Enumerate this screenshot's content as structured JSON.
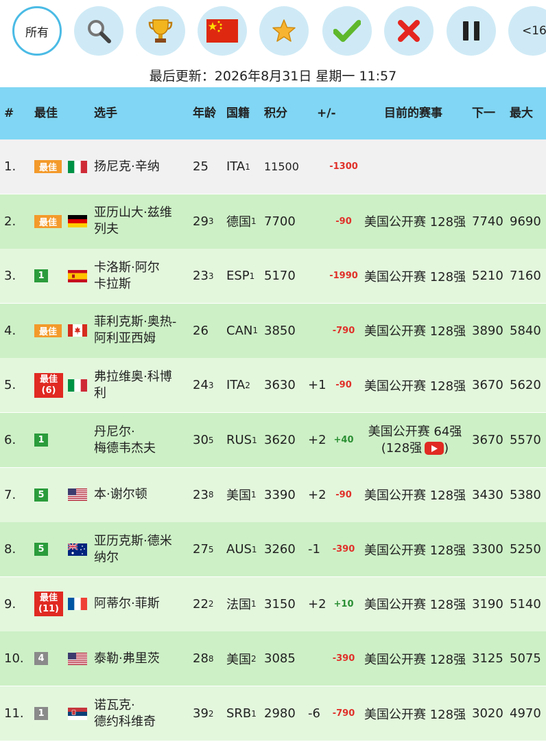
{
  "filter_bar": {
    "all_label": "所有",
    "more_label": "<16",
    "buttons": [
      {
        "name": "all-filter-button",
        "icon": "text"
      },
      {
        "name": "search-filter-button",
        "icon": "search-icon"
      },
      {
        "name": "trophy-filter-button",
        "icon": "trophy-icon"
      },
      {
        "name": "china-filter-button",
        "icon": "china-flag-icon"
      },
      {
        "name": "star-filter-button",
        "icon": "star-icon"
      },
      {
        "name": "check-filter-button",
        "icon": "check-icon"
      },
      {
        "name": "cross-filter-button",
        "icon": "cross-icon"
      },
      {
        "name": "pause-filter-button",
        "icon": "pause-icon"
      },
      {
        "name": "under16-filter-button",
        "icon": "text"
      }
    ]
  },
  "update_line": "最后更新：2026年8月31日 星期一 11:57",
  "table": {
    "headers": {
      "rank": "#",
      "best": "最佳",
      "player": "选手",
      "age": "年龄",
      "country": "国籍",
      "points": "积分",
      "plusminus": "+/-",
      "event": "目前的赛事",
      "next": "下一",
      "max": "最大"
    },
    "colors": {
      "header_bg": "#80d6f4",
      "row_odd": "#e3f7dd",
      "row_even": "#cdf0c6",
      "first_row": "#f1f1f1"
    },
    "rows": [
      {
        "rank": "1.",
        "best": {
          "type": "best",
          "text": "最佳"
        },
        "flag": "italy-flag-icon",
        "name": "扬尼克·辛纳",
        "name2": "",
        "age": "25",
        "age_sub": "",
        "country": "ITA",
        "country_sub": "1",
        "points": "11500",
        "move": "",
        "change": "-1300",
        "change_type": "neg",
        "event": "",
        "event2": "",
        "yt": false,
        "next": "",
        "max": ""
      },
      {
        "rank": "2.",
        "best": {
          "type": "best",
          "text": "最佳"
        },
        "flag": "germany-flag-icon",
        "name": "亚历山大·兹维",
        "name2": "列夫",
        "age": "29",
        "age_sub": "3",
        "country": "德国",
        "country_sub": "1",
        "points": "7700",
        "move": "",
        "change": "-90",
        "change_type": "neg",
        "event": "美国公开赛 128强",
        "event2": "",
        "yt": false,
        "next": "7740",
        "max": "9690"
      },
      {
        "rank": "3.",
        "best": {
          "type": "green",
          "text": "1"
        },
        "flag": "spain-flag-icon",
        "name": "卡洛斯·阿尔",
        "name2": "卡拉斯",
        "age": "23",
        "age_sub": "3",
        "country": "ESP",
        "country_sub": "1",
        "points": "5170",
        "move": "",
        "change": "-1990",
        "change_type": "neg",
        "event": "美国公开赛 128强",
        "event2": "",
        "yt": false,
        "next": "5210",
        "max": "7160"
      },
      {
        "rank": "4.",
        "best": {
          "type": "best",
          "text": "最佳"
        },
        "flag": "canada-flag-icon",
        "name": "菲利克斯·奥热-",
        "name2": "阿利亚西姆",
        "age": "26",
        "age_sub": "",
        "country": "CAN",
        "country_sub": "1",
        "points": "3850",
        "move": "",
        "change": "-790",
        "change_type": "neg",
        "event": "美国公开赛 128强",
        "event2": "",
        "yt": false,
        "next": "3890",
        "max": "5840"
      },
      {
        "rank": "5.",
        "best": {
          "type": "red",
          "text": "最佳",
          "text2": "(6)"
        },
        "flag": "italy-flag-icon",
        "name": "弗拉维奥·科博",
        "name2": "利",
        "age": "24",
        "age_sub": "3",
        "country": "ITA",
        "country_sub": "2",
        "points": "3630",
        "move": "+1",
        "change": "-90",
        "change_type": "neg",
        "event": "美国公开赛 128强",
        "event2": "",
        "yt": false,
        "next": "3670",
        "max": "5620"
      },
      {
        "rank": "6.",
        "best": {
          "type": "green",
          "text": "1"
        },
        "flag": "",
        "name": "丹尼尔·",
        "name2": "梅德韦杰夫",
        "age": "30",
        "age_sub": "5",
        "country": "RUS",
        "country_sub": "1",
        "points": "3620",
        "move": "+2",
        "change": "+40",
        "change_type": "pos",
        "event": "美国公开赛 64强",
        "event2": "(128强",
        "event2_tail": ")",
        "yt": true,
        "next": "3670",
        "max": "5570"
      },
      {
        "rank": "7.",
        "best": {
          "type": "green",
          "text": "5"
        },
        "flag": "usa-flag-icon",
        "name": "本·谢尔顿",
        "name2": "",
        "age": "23",
        "age_sub": "8",
        "country": "美国",
        "country_sub": "1",
        "points": "3390",
        "move": "+2",
        "change": "-90",
        "change_type": "neg",
        "event": "美国公开赛 128强",
        "event2": "",
        "yt": false,
        "next": "3430",
        "max": "5380"
      },
      {
        "rank": "8.",
        "best": {
          "type": "green",
          "text": "5"
        },
        "flag": "australia-flag-icon",
        "name": "亚历克斯·德米",
        "name2": "纳尔",
        "age": "27",
        "age_sub": "5",
        "country": "AUS",
        "country_sub": "1",
        "points": "3260",
        "move": "-1",
        "change": "-390",
        "change_type": "neg",
        "event": "美国公开赛 128强",
        "event2": "",
        "yt": false,
        "next": "3300",
        "max": "5250"
      },
      {
        "rank": "9.",
        "best": {
          "type": "red",
          "text": "最佳",
          "text2": "(11)"
        },
        "flag": "france-flag-icon",
        "name": "阿蒂尔·菲斯",
        "name2": "",
        "age": "22",
        "age_sub": "2",
        "country": "法国",
        "country_sub": "1",
        "points": "3150",
        "move": "+2",
        "change": "+10",
        "change_type": "pos",
        "event": "美国公开赛 128强",
        "event2": "",
        "yt": false,
        "next": "3190",
        "max": "5140"
      },
      {
        "rank": "10.",
        "best": {
          "type": "gray",
          "text": "4"
        },
        "flag": "usa-flag-icon",
        "name": "泰勒·弗里茨",
        "name2": "",
        "age": "28",
        "age_sub": "8",
        "country": "美国",
        "country_sub": "2",
        "points": "3085",
        "move": "",
        "change": "-390",
        "change_type": "neg",
        "event": "美国公开赛 128强",
        "event2": "",
        "yt": false,
        "next": "3125",
        "max": "5075"
      },
      {
        "rank": "11.",
        "best": {
          "type": "gray",
          "text": "1"
        },
        "flag": "serbia-flag-icon",
        "name": "诺瓦克·",
        "name2": "德约科维奇",
        "age": "39",
        "age_sub": "2",
        "country": "SRB",
        "country_sub": "1",
        "points": "2980",
        "move": "-6",
        "change": "-790",
        "change_type": "neg",
        "event": "美国公开赛 128强",
        "event2": "",
        "yt": false,
        "next": "3020",
        "max": "4970"
      }
    ]
  }
}
